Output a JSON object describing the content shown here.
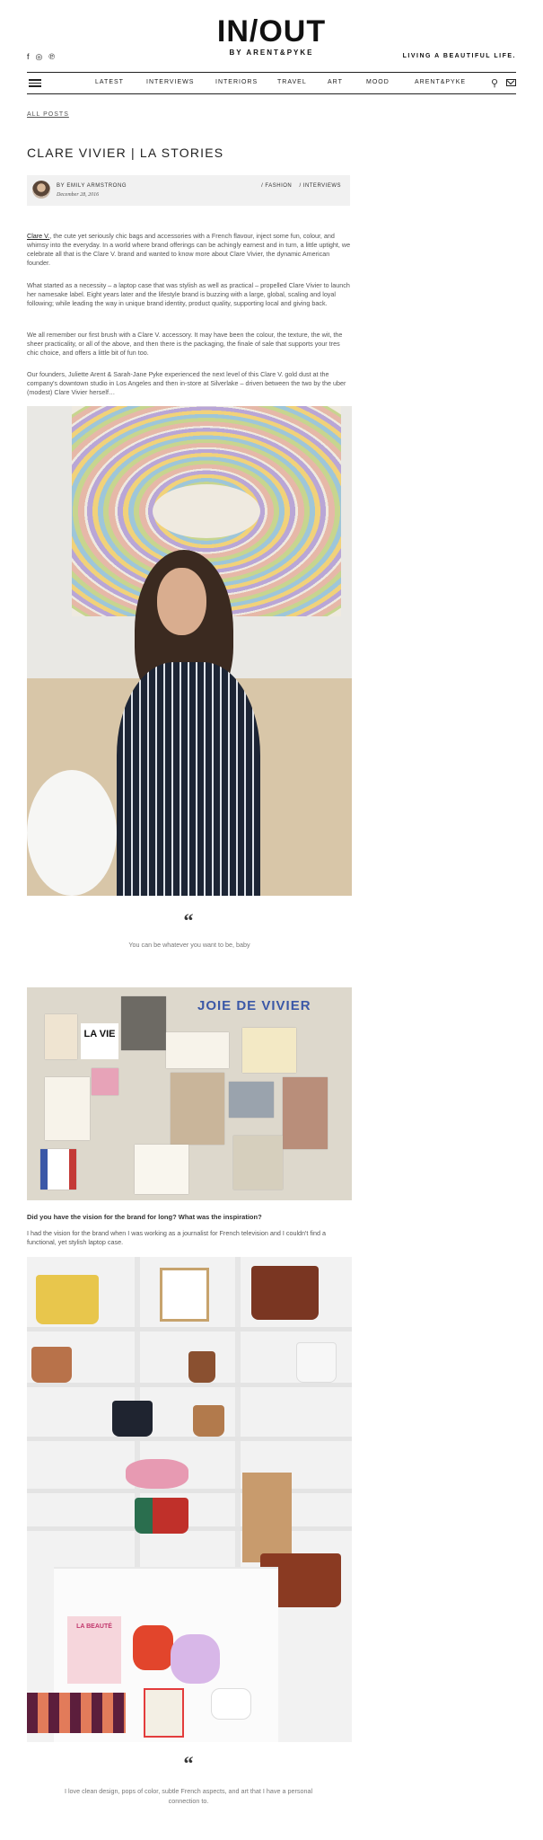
{
  "header": {
    "logo_main": "IN/OUT",
    "logo_sub": "BY ARENT&PYKE",
    "tagline": "LIVING A BEAUTIFUL LIFE.",
    "social": [
      {
        "icon": "facebook-icon",
        "glyph": "f"
      },
      {
        "icon": "instagram-icon",
        "glyph": "◎"
      },
      {
        "icon": "pinterest-icon",
        "glyph": "℗"
      }
    ]
  },
  "nav": {
    "items": [
      "LATEST",
      "INTERVIEWS",
      "INTERIORS",
      "TRAVEL",
      "ART",
      "MOOD",
      "ARENT&PYKE"
    ],
    "search_icon": "search-icon",
    "mail_icon": "mail-icon",
    "menu_icon": "menu-icon"
  },
  "breadcrumb": "ALL POSTS",
  "post": {
    "title": "CLARE VIVIER | LA STORIES",
    "author": "BY EMILY ARMSTRONG",
    "date": "December 28, 2016",
    "tags": [
      "/ FASHION",
      "/ INTERVIEWS"
    ],
    "para1_link": "Clare V.",
    "para1": ", the cute yet seriously chic bags and accessories with a French flavour, inject some fun, colour, and whimsy into the everyday. In a world where brand offerings can be achingly earnest and in turn, a little uptight, we celebrate all that is the Clare V. brand and wanted to know more about Clare Vivier, the dynamic American founder.",
    "para2": "What started as a necessity – a laptop case that was stylish as well as practical – propelled Clare Vivier to launch her namesake label. Eight years later and the lifestyle brand is buzzing with a large, global, scaling and loyal following; while leading the way in unique brand identity, product quality, supporting local and giving back.",
    "para3": "We all remember our first brush with a Clare V. accessory. It may have been the colour, the texture, the wit, the sheer practicality, or all of the above, and then there is the packaging, the finale of sale that supports your tres chic choice, and offers a little bit of fun too.",
    "para4": "Our founders, Juliette Arent & Sarah-Jane Pyke experienced the next level of this Clare V. gold dust at the company's downtown studio in Los Angeles and then in-store at Silverlake – driven between the two by the uber (modest) Clare Vivier herself…",
    "quote1": "You can be whatever you want to be, baby",
    "board_text_1": "JOIE DE VIVIER",
    "board_text_2": "LA VIE",
    "question1": "Did you have the vision for the brand for long? What was the inspiration?",
    "answer1": "I had the vision for the brand when I was working as a journalist for French television and I couldn't find a functional, yet stylish laptop case.",
    "book_text": "LA BEAUTÉ",
    "quote2": "I love clean design, pops of color, subtle French aspects, and art that I have a personal connection to."
  },
  "colors": {
    "text": "#555555",
    "heading": "#222222",
    "meta_bg": "#f1f1f1",
    "accent_blue": "#3b58a7"
  }
}
